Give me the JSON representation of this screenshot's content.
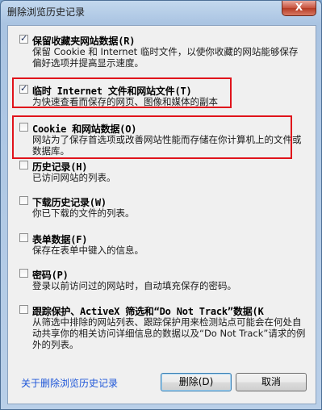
{
  "window": {
    "title": "删除浏览历史记录",
    "close_glyph": "X"
  },
  "options": [
    {
      "id": "favorites",
      "checked": true,
      "title": "保留收藏夹网站数据(R)",
      "desc": "保留 Cookie 和 Internet 临时文件，以使你收藏的网站能够保存偏好选项并提高显示速度。"
    },
    {
      "id": "temp-files",
      "checked": true,
      "title": "临时 Internet 文件和网站文件(T)",
      "desc": "为快速查看而保存的网页、图像和媒体的副本"
    },
    {
      "id": "cookies",
      "checked": false,
      "title": "Cookie 和网站数据(O)",
      "desc": "网站为了保存首选项或改善网站性能而存储在你计算机上的文件或数据库。"
    },
    {
      "id": "history",
      "checked": false,
      "title": "历史记录(H)",
      "desc": "已访问网站的列表。"
    },
    {
      "id": "download-history",
      "checked": false,
      "title": "下载历史记录(W)",
      "desc": "你已下载的文件的列表。"
    },
    {
      "id": "form-data",
      "checked": false,
      "title": "表单数据(F)",
      "desc": "保存在表单中键入的信息。"
    },
    {
      "id": "passwords",
      "checked": false,
      "title": "密码(P)",
      "desc": "登录以前访问过的网站时，自动填充保存的密码。"
    },
    {
      "id": "tracking",
      "checked": false,
      "title": "跟踪保护、ActiveX 筛选和“Do Not Track”数据(K",
      "desc": "从筛选中排除的网站列表、跟踪保护用来检测站点可能会在何处自动共享你的相关访问详细信息的数据以及“Do Not Track”请求的例外的列表。"
    }
  ],
  "footer": {
    "link": "关于删除浏览历史记录",
    "delete_label": "删除(D)",
    "cancel_label": "取消"
  }
}
